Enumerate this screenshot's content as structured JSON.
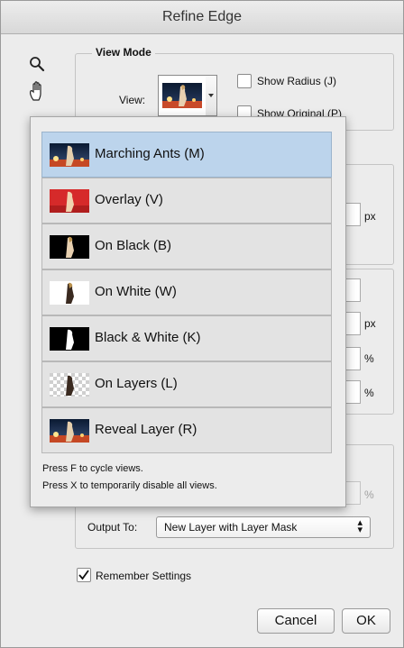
{
  "dialog": {
    "title": "Refine Edge",
    "tools": [
      {
        "name": "zoom-tool-icon",
        "glyph": "⚲"
      },
      {
        "name": "hand-tool-icon",
        "glyph": "✋"
      }
    ]
  },
  "view_mode": {
    "legend": "View Mode",
    "view_label": "View:",
    "show_radius": {
      "label": "Show Radius (J)",
      "checked": false
    },
    "show_original": {
      "label": "Show Original (P)",
      "checked": false
    }
  },
  "view_menu": {
    "items": [
      {
        "label": "Marching Ants (M)",
        "thumb": "marching-ants",
        "selected": true
      },
      {
        "label": "Overlay (V)",
        "thumb": "overlay",
        "selected": false
      },
      {
        "label": "On Black (B)",
        "thumb": "on-black",
        "selected": false
      },
      {
        "label": "On White (W)",
        "thumb": "on-white",
        "selected": false
      },
      {
        "label": "Black & White (K)",
        "thumb": "black-white",
        "selected": false
      },
      {
        "label": "On Layers (L)",
        "thumb": "on-layers",
        "selected": false
      },
      {
        "label": "Reveal Layer (R)",
        "thumb": "reveal-layer",
        "selected": false
      }
    ],
    "help_1": "Press F to cycle views.",
    "help_2": "Press X to temporarily disable all views."
  },
  "background_units": {
    "px_1": "px",
    "px_2": "px",
    "pct_1": "%",
    "pct_2": "%",
    "pct_3": "%"
  },
  "output": {
    "output_to_label": "Output To:",
    "output_to_value": "New Layer with Layer Mask",
    "remember_settings": {
      "label": "Remember Settings",
      "checked": true
    }
  },
  "buttons": {
    "cancel": "Cancel",
    "ok": "OK"
  }
}
